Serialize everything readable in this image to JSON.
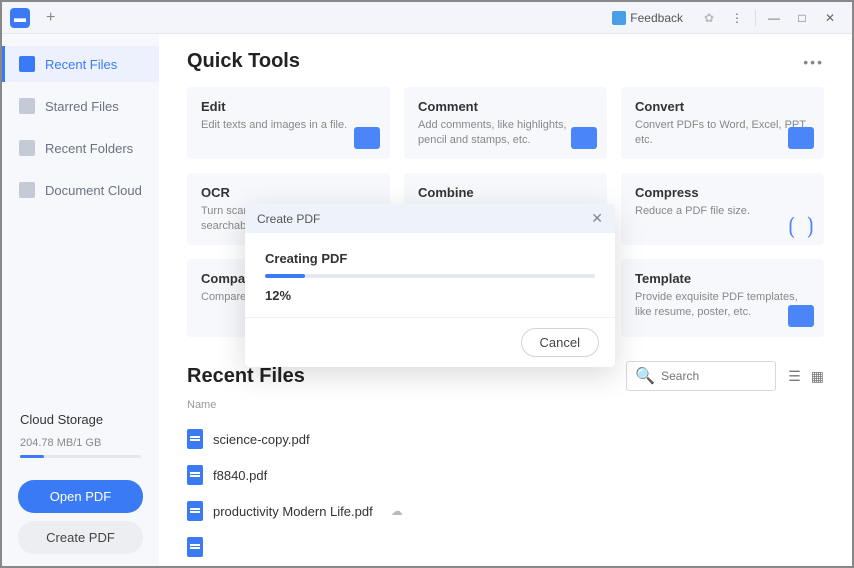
{
  "titlebar": {
    "feedback_label": "Feedback"
  },
  "sidebar": {
    "items": [
      {
        "label": "Recent Files"
      },
      {
        "label": "Starred Files"
      },
      {
        "label": "Recent Folders"
      },
      {
        "label": "Document Cloud"
      }
    ],
    "cloud_title": "Cloud Storage",
    "cloud_usage": "204.78 MB/1 GB",
    "open_pdf_label": "Open PDF",
    "create_pdf_label": "Create PDF"
  },
  "quick_tools": {
    "heading": "Quick Tools",
    "cards": [
      {
        "title": "Edit",
        "desc": "Edit texts and images in a file."
      },
      {
        "title": "Comment",
        "desc": "Add comments, like highlights, pencil and stamps, etc."
      },
      {
        "title": "Convert",
        "desc": "Convert PDFs to Word, Excel, PPT, etc."
      },
      {
        "title": "OCR",
        "desc": "Turn scanned PDFs into searchable documents."
      },
      {
        "title": "Combine",
        "desc": ""
      },
      {
        "title": "Compress",
        "desc": "Reduce a PDF file size."
      },
      {
        "title": "Compare",
        "desc": "Compare differences in files."
      },
      {
        "title": "",
        "desc": ""
      },
      {
        "title": "Template",
        "desc": "Provide exquisite PDF templates, like resume, poster, etc."
      }
    ]
  },
  "recent": {
    "heading": "Recent Files",
    "search_placeholder": "Search",
    "name_col": "Name",
    "files": [
      {
        "name": "science-copy.pdf"
      },
      {
        "name": "f8840.pdf"
      },
      {
        "name": "productivity Modern Life.pdf"
      }
    ]
  },
  "modal": {
    "title": "Create PDF",
    "status": "Creating PDF",
    "percent_text": "12%",
    "progress_width": "12%",
    "cancel_label": "Cancel"
  }
}
